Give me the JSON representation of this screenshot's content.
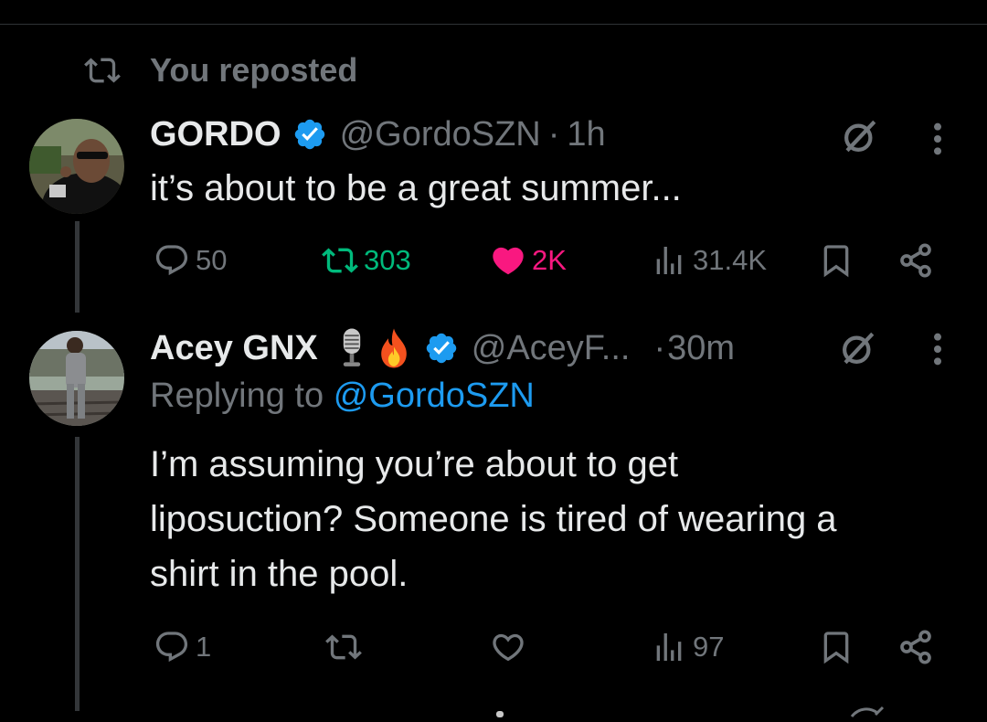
{
  "repost_label": "You reposted",
  "colors": {
    "background": "#000000",
    "text": "#e7e9ea",
    "muted": "#71767b",
    "link": "#1d9bf0",
    "repost_active": "#00ba7c",
    "like_active": "#f91880",
    "verified": "#1d9bf0"
  },
  "tweets": [
    {
      "author_name": "GORDO",
      "verified": true,
      "handle": "@GordoSZN",
      "separator": "·",
      "time": "1h",
      "text_lines": [
        "it’s about to be a great summer..."
      ],
      "actions": {
        "replies": "50",
        "reposts": "303",
        "likes": "2K",
        "views": "31.4K",
        "reposted": true,
        "liked": true
      }
    },
    {
      "author_name": "Acey GNX",
      "emojis": [
        "microphone-emoji",
        "fire-emoji"
      ],
      "verified": true,
      "handle": "@AceyF...",
      "separator": "·",
      "time": "30m",
      "replying_prefix": "Replying to",
      "replying_to": "@GordoSZN",
      "text_lines": [
        "I’m assuming you’re about to get",
        "liposuction? Someone is tired of wearing a",
        "shirt in the pool."
      ],
      "actions": {
        "replies": "1",
        "reposts": "",
        "likes": "",
        "views": "97",
        "reposted": false,
        "liked": false
      }
    }
  ]
}
